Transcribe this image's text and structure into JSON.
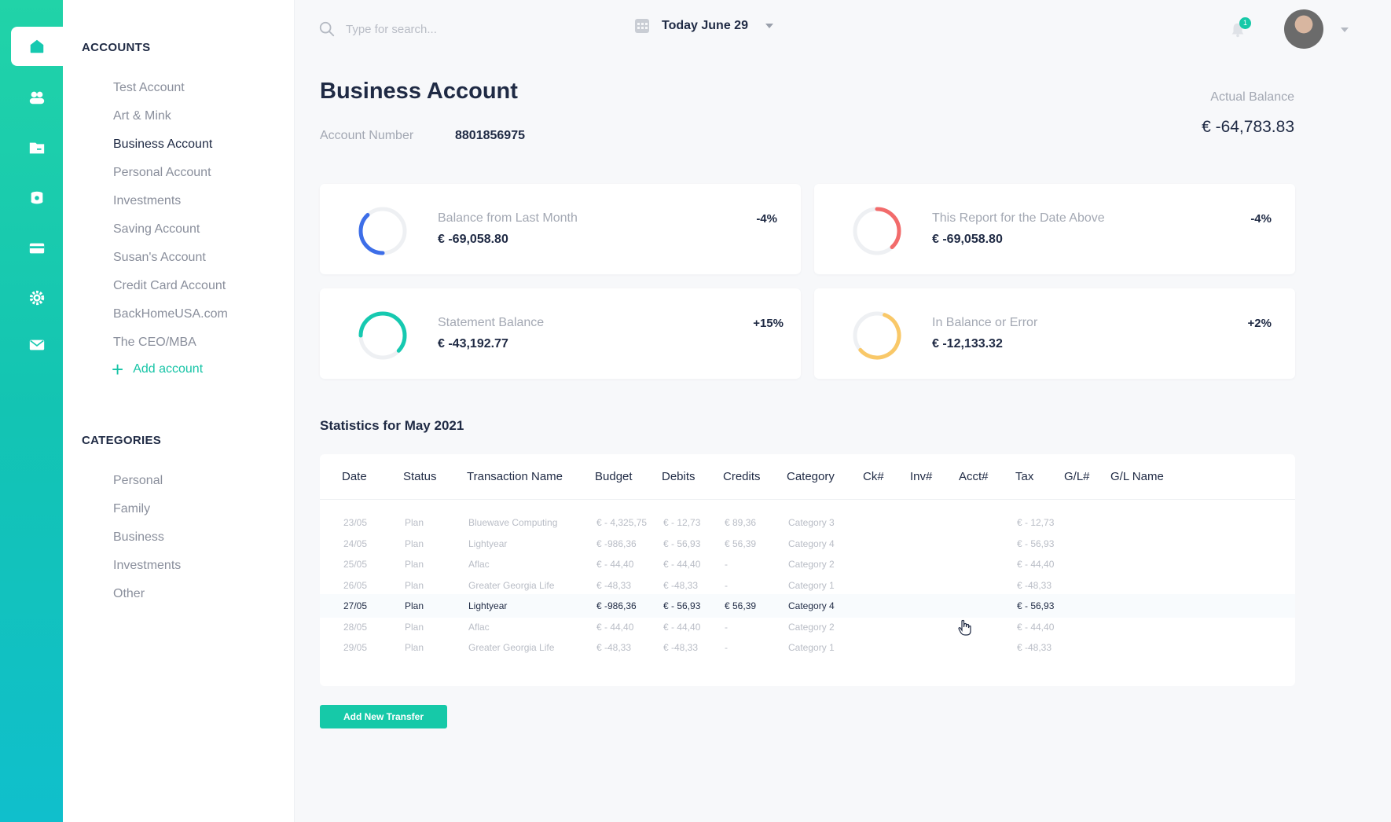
{
  "search": {
    "placeholder": "Type for search..."
  },
  "date_selector": {
    "label": "Today June 29"
  },
  "notifications": {
    "count": "1"
  },
  "accounts": {
    "heading": "ACCOUNTS",
    "items": [
      "Test Account",
      "Art & Mink",
      "Business Account",
      "Personal Account",
      "Investments",
      "Saving Account",
      "Susan's Account",
      "Credit Card Account",
      "BackHomeUSA.com",
      "The CEO/MBA"
    ],
    "active": "Business Account",
    "add_label": "Add account"
  },
  "categories": {
    "heading": "CATEGORIES",
    "items": [
      "Personal",
      "Family",
      "Business",
      "Investments",
      "Other"
    ]
  },
  "account": {
    "title": "Business Account",
    "number_label": "Account Number",
    "number": "8801856975",
    "balance_label": "Actual Balance",
    "balance": "€ -64,783.83"
  },
  "cards": [
    {
      "label": "Balance from Last Month",
      "value": "€ -69,058.80",
      "pct": "-4%",
      "color": "#3d6ee8",
      "fraction": 0.38,
      "start_deg": 90
    },
    {
      "label": "This Report for the Date Above",
      "value": "€ -69,058.80",
      "pct": "-4%",
      "color": "#f26b6b",
      "fraction": 0.38,
      "start_deg": 270
    },
    {
      "label": "Statement Balance",
      "value": "€ -43,192.77",
      "pct": "+15%",
      "color": "#16c9b0",
      "fraction": 0.62,
      "start_deg": 180
    },
    {
      "label": "In Balance or Error",
      "value": "€ -12,133.32",
      "pct": "+2%",
      "color": "#f9c868",
      "fraction": 0.58,
      "start_deg": 290
    }
  ],
  "stats": {
    "title": "Statistics for May 2021",
    "columns": [
      "Date",
      "Status",
      "Transaction Name",
      "Budget",
      "Debits",
      "Credits",
      "Category",
      "Ck#",
      "Inv#",
      "Acct#",
      "Tax",
      "G/L#",
      "G/L Name"
    ],
    "rows": [
      [
        "23/05",
        "Plan",
        "Bluewave Computing",
        "€ - 4,325,75",
        "€ - 12,73",
        "€ 89,36",
        "Category 3",
        "",
        "",
        "",
        "€ - 12,73",
        "",
        ""
      ],
      [
        "24/05",
        "Plan",
        "Lightyear",
        "€ -986,36",
        "€ - 56,93",
        "€ 56,39",
        "Category 4",
        "",
        "",
        "",
        "€ - 56,93",
        "",
        ""
      ],
      [
        "25/05",
        "Plan",
        "Aflac",
        "€ - 44,40",
        "€ - 44,40",
        "-",
        "Category 2",
        "",
        "",
        "",
        "€ - 44,40",
        "",
        ""
      ],
      [
        "26/05",
        "Plan",
        "Greater Georgia Life",
        "€ -48,33",
        "€ -48,33",
        "-",
        "Category 1",
        "",
        "",
        "",
        "€ -48,33",
        "",
        ""
      ],
      [
        "27/05",
        "Plan",
        "Lightyear",
        "€ -986,36",
        "€ - 56,93",
        "€ 56,39",
        "Category 4",
        "",
        "",
        "",
        "€ - 56,93",
        "",
        ""
      ],
      [
        "28/05",
        "Plan",
        "Aflac",
        "€ - 44,40",
        "€ - 44,40",
        "-",
        "Category 2",
        "",
        "",
        "",
        "€ - 44,40",
        "",
        ""
      ],
      [
        "29/05",
        "Plan",
        "Greater Georgia Life",
        "€ -48,33",
        "€ -48,33",
        "-",
        "Category 1",
        "",
        "",
        "",
        "€ -48,33",
        "",
        ""
      ]
    ],
    "highlighted_row": 4
  },
  "add_transfer_label": "Add New Transfer",
  "colors": {
    "accent": "#16c9a8",
    "text": "#1f2a44",
    "muted": "#a3a8b3"
  }
}
